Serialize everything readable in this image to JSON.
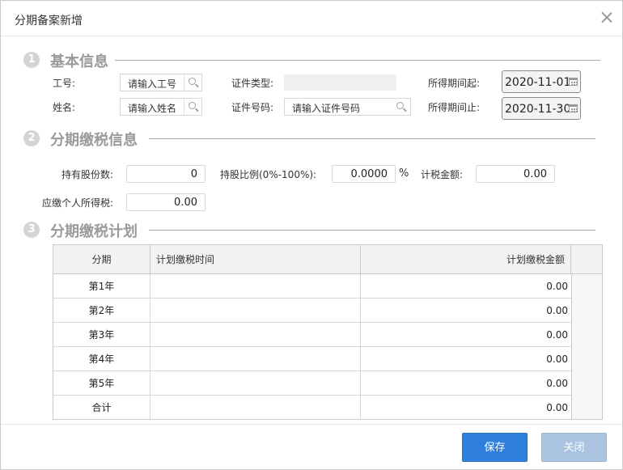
{
  "dialog": {
    "title": "分期备案新增"
  },
  "section1": {
    "num": "1",
    "title": "基本信息",
    "emp_id_label": "工号:",
    "emp_id_placeholder": "请输入工号",
    "name_label": "姓名:",
    "name_placeholder": "请输入姓名",
    "id_type_label": "证件类型:",
    "id_no_label": "证件号码:",
    "id_no_placeholder": "请输入证件号码",
    "period_start_label": "所得期间起:",
    "period_start_value": "2020-11-01",
    "period_end_label": "所得期间止:",
    "period_end_value": "2020-11-30"
  },
  "section2": {
    "num": "2",
    "title": "分期缴税信息",
    "shares_label": "持有股份数:",
    "shares_value": "0",
    "ratio_label": "持股比例(0%-100%):",
    "ratio_value": "0.0000",
    "ratio_unit": "%",
    "taxable_label": "计税金额:",
    "taxable_value": "0.00",
    "tax_due_label": "应缴个人所得税:",
    "tax_due_value": "0.00"
  },
  "section3": {
    "num": "3",
    "title": "分期缴税计划",
    "columns": [
      "分期",
      "计划缴税时间",
      "计划缴税金额"
    ],
    "rows": [
      {
        "period": "第1年",
        "time": "",
        "amount": "0.00"
      },
      {
        "period": "第2年",
        "time": "",
        "amount": "0.00"
      },
      {
        "period": "第3年",
        "time": "",
        "amount": "0.00"
      },
      {
        "period": "第4年",
        "time": "",
        "amount": "0.00"
      },
      {
        "period": "第5年",
        "time": "",
        "amount": "0.00"
      },
      {
        "period": "合计",
        "time": "",
        "amount": "0.00"
      }
    ]
  },
  "footer": {
    "save_label": "保存",
    "close_label": "关闭"
  },
  "colors": {
    "primary": "#2f80dc",
    "disabled": "#a9c3e0",
    "section_gray": "#9a9a9a"
  }
}
